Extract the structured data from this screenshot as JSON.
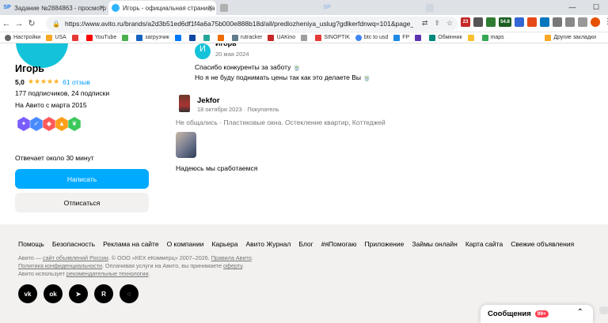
{
  "browser": {
    "tabs": [
      {
        "label": "Задание №2884863 - просмотр з",
        "fav": "SP",
        "fav_color": "#1a73e8"
      },
      {
        "label": "Игорь - официальная страница п",
        "fav": "",
        "fav_color": "#2fb4ff"
      },
      {
        "label": "",
        "fav": "",
        "fav_color": "#b0b0b0"
      },
      {
        "label": "",
        "fav": "SP",
        "fav_color": "#9dbce8"
      },
      {
        "label": "",
        "fav": "",
        "fav_color": "#cfd6e0"
      },
      {
        "label": "",
        "fav": "",
        "fav_color": "#cfd6e0"
      }
    ],
    "url": "https://www.avito.ru/brands/a2d3b51ed6df1f4a6a75b000e888b18d/all/predlozheniya_uslug?gdlkerfdnwq=101&page_from=from_i...",
    "ext_badges": [
      "23",
      "LTC",
      "54.8"
    ],
    "bookmarks": [
      "Настройки",
      "USA",
      "",
      "YouTube",
      "",
      "загрузчик",
      "",
      "",
      "",
      "",
      "rutracker",
      "UAKino",
      "",
      "SINOPTIK",
      "btc to usd",
      "FP",
      "",
      "Обмінник",
      "",
      "maps"
    ],
    "bookmarks_right": "Другие закладки"
  },
  "seller": {
    "name": "Игорь",
    "score": "5,0",
    "stars": "★★★★★",
    "reviews": "61 отзыв",
    "subs": "177 подписчиков, 24 подписки",
    "since": "На Авито с марта 2015",
    "reply_time": "Отвечает около 30 минут",
    "write_label": "Написать",
    "unsub_label": "Отписаться"
  },
  "reviews": {
    "top": {
      "avatar_letter": "И",
      "name": "Игорь",
      "date": "20 мая 2024",
      "line1": "Спасибо конкуренты за заботу 🍵",
      "line2": "Но я не буду поднимать цены так как это делаете Вы 🍵"
    },
    "second": {
      "name": "Jekfor",
      "meta": "18 октября 2023 · Покупатель",
      "tags": "Не общались · Пластиковые окна. Остекление квартир, Коттеджей",
      "text": "Надеюсь мы сработаемся"
    }
  },
  "footer": {
    "links": [
      "Помощь",
      "Безопасность",
      "Реклама на сайте",
      "О компании",
      "Карьера",
      "Авито Журнал",
      "Блог",
      "#яПомогаю",
      "Приложение",
      "Займы онлайн",
      "Карта сайта",
      "Свежие объявления"
    ],
    "legal1_a": "Авито — ",
    "legal1_link": "сайт объявлений России",
    "legal1_b": ". © ООО «КЕХ еКоммерц» 2007–2026. ",
    "legal1_link2": "Правила Авито",
    "legal1_c": ".",
    "legal2_link": "Политика конфиденциальности",
    "legal2_b": ". Оплачивая услуги на Авито, вы принимаете ",
    "legal2_link2": "оферту",
    "legal2_c": ".",
    "legal3_a": "Авито использует ",
    "legal3_link": "рекомендательные технологии",
    "legal3_c": ".",
    "social": [
      "VK",
      "OK",
      "TG",
      "R",
      "D"
    ]
  },
  "messages": {
    "label": "Сообщения",
    "count": "99+"
  },
  "colors": {
    "accent": "#00aaff",
    "star": "#ffb021",
    "avatar": "#14c3d9",
    "footer_bg": "#f2f1f0"
  }
}
